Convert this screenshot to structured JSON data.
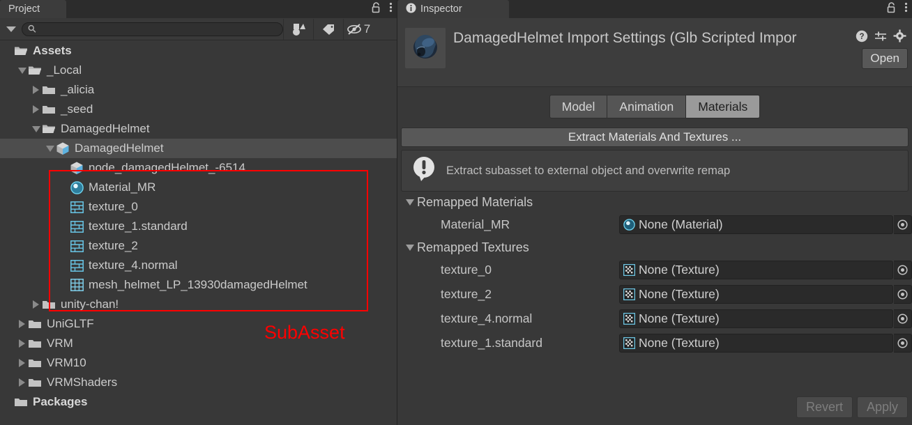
{
  "project": {
    "tab_label": "Project",
    "search_placeholder": "",
    "search_value": "",
    "filter_buttons": [
      {
        "name": "type-filter",
        "label": ""
      },
      {
        "name": "label-filter",
        "label": ""
      },
      {
        "name": "hidden-filter",
        "label": "7"
      }
    ],
    "tree": [
      {
        "label": "Assets",
        "depth": 0,
        "fold": "none",
        "icon": "folder-open-icon",
        "bold": true,
        "selected": false
      },
      {
        "label": "_Local",
        "depth": 1,
        "fold": "open",
        "icon": "folder-open-icon",
        "bold": false,
        "selected": false
      },
      {
        "label": "_alicia",
        "depth": 2,
        "fold": "closed",
        "icon": "folder-icon",
        "bold": false,
        "selected": false
      },
      {
        "label": "_seed",
        "depth": 2,
        "fold": "closed",
        "icon": "folder-icon",
        "bold": false,
        "selected": false
      },
      {
        "label": "DamagedHelmet",
        "depth": 2,
        "fold": "open",
        "icon": "folder-open-icon",
        "bold": false,
        "selected": false
      },
      {
        "label": "DamagedHelmet",
        "depth": 3,
        "fold": "open",
        "icon": "prefab-icon",
        "bold": false,
        "selected": true
      },
      {
        "label": "node_damagedHelmet_-6514",
        "depth": 4,
        "fold": "none",
        "icon": "prefab-icon",
        "bold": false,
        "selected": false
      },
      {
        "label": "Material_MR",
        "depth": 4,
        "fold": "none",
        "icon": "material-icon",
        "bold": false,
        "selected": false
      },
      {
        "label": "texture_0",
        "depth": 4,
        "fold": "none",
        "icon": "texture-icon",
        "bold": false,
        "selected": false
      },
      {
        "label": "texture_1.standard",
        "depth": 4,
        "fold": "none",
        "icon": "texture-icon",
        "bold": false,
        "selected": false
      },
      {
        "label": "texture_2",
        "depth": 4,
        "fold": "none",
        "icon": "texture-icon",
        "bold": false,
        "selected": false
      },
      {
        "label": "texture_4.normal",
        "depth": 4,
        "fold": "none",
        "icon": "texture-icon",
        "bold": false,
        "selected": false
      },
      {
        "label": "mesh_helmet_LP_13930damagedHelmet",
        "depth": 4,
        "fold": "none",
        "icon": "mesh-icon",
        "bold": false,
        "selected": false
      },
      {
        "label": "unity-chan!",
        "depth": 2,
        "fold": "closed",
        "icon": "folder-icon",
        "bold": false,
        "selected": false
      },
      {
        "label": "UniGLTF",
        "depth": 1,
        "fold": "closed",
        "icon": "folder-icon",
        "bold": false,
        "selected": false
      },
      {
        "label": "VRM",
        "depth": 1,
        "fold": "closed",
        "icon": "folder-icon",
        "bold": false,
        "selected": false
      },
      {
        "label": "VRM10",
        "depth": 1,
        "fold": "closed",
        "icon": "folder-icon",
        "bold": false,
        "selected": false
      },
      {
        "label": "VRMShaders",
        "depth": 1,
        "fold": "closed",
        "icon": "folder-icon",
        "bold": false,
        "selected": false
      },
      {
        "label": "Packages",
        "depth": 0,
        "fold": "none",
        "icon": "folder-icon",
        "bold": true,
        "selected": false
      }
    ],
    "annotation": {
      "label": "SubAsset",
      "color": "#ff0000"
    }
  },
  "inspector": {
    "tab_label": "Inspector",
    "title": "DamagedHelmet Import Settings (Glb Scripted Impor",
    "open_button": "Open",
    "tabs": [
      {
        "label": "Model",
        "active": false
      },
      {
        "label": "Animation",
        "active": false
      },
      {
        "label": "Materials",
        "active": true
      }
    ],
    "extract_button": "Extract Materials And Textures ...",
    "help_message": "Extract subasset to external object and overwrite remap",
    "sections": [
      {
        "name": "Remapped Materials",
        "rows": [
          {
            "label": "Material_MR",
            "value": "None (Material)",
            "value_icon": "material-icon"
          }
        ]
      },
      {
        "name": "Remapped Textures",
        "rows": [
          {
            "label": "texture_0",
            "value": "None (Texture)",
            "value_icon": "texture-icon"
          },
          {
            "label": "texture_2",
            "value": "None (Texture)",
            "value_icon": "texture-icon"
          },
          {
            "label": "texture_4.normal",
            "value": "None (Texture)",
            "value_icon": "texture-icon"
          },
          {
            "label": "texture_1.standard",
            "value": "None (Texture)",
            "value_icon": "texture-icon"
          }
        ]
      }
    ],
    "footer": {
      "revert": "Revert",
      "apply": "Apply"
    }
  },
  "colors": {
    "panel_bg": "#383838",
    "tab_bg": "#3c3c3c",
    "selected_row": "#4d4d4d",
    "annotation_red": "#ff0000",
    "accent_blue": "#5ec8e8"
  }
}
